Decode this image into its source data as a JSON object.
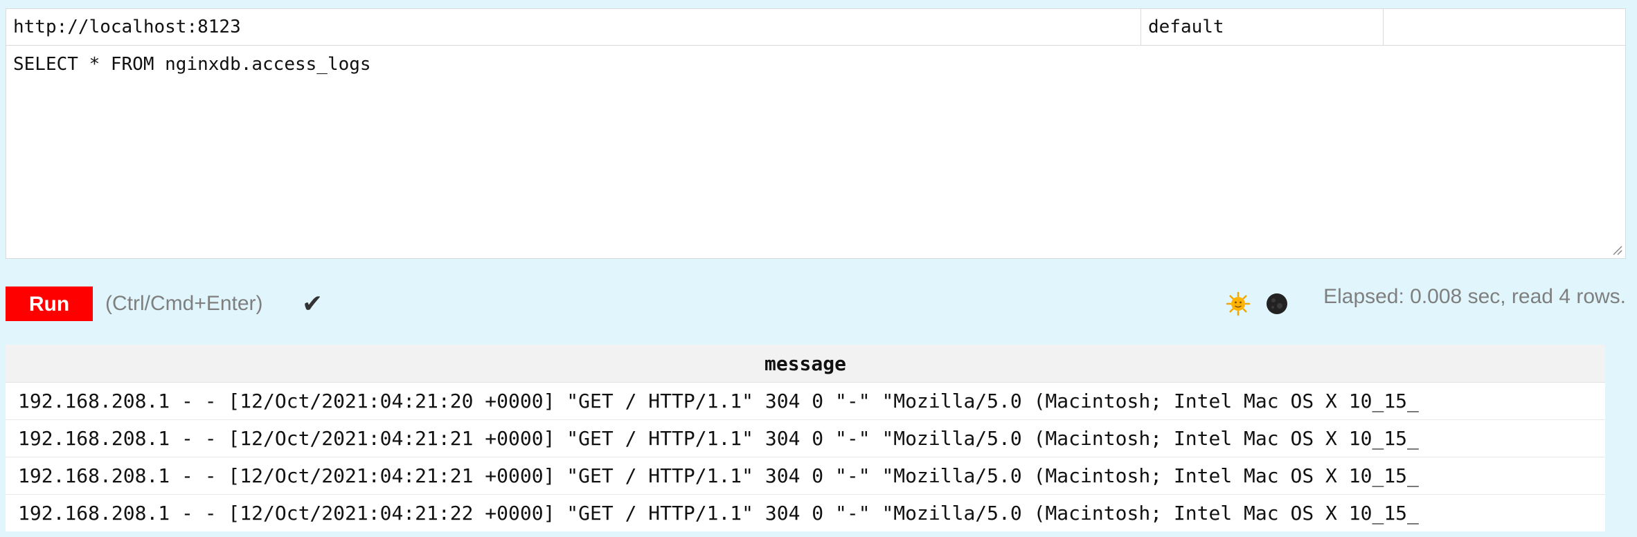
{
  "connection": {
    "url": "http://localhost:8123",
    "user": "default",
    "password": ""
  },
  "query": {
    "text": "SELECT * FROM nginxdb.access_logs"
  },
  "controls": {
    "run_label": "Run",
    "shortcut_hint": "(Ctrl/Cmd+Enter)",
    "status_check": "✔",
    "elapsed": "Elapsed: 0.008 sec, read 4 rows."
  },
  "theme": {
    "light_icon": "sun-icon",
    "dark_icon": "moon-icon",
    "run_color": "#ff0000",
    "background": "#e0f6fc"
  },
  "results": {
    "columns": [
      "message"
    ],
    "rows": [
      "192.168.208.1 - - [12/Oct/2021:04:21:20 +0000] \"GET / HTTP/1.1\" 304 0 \"-\" \"Mozilla/5.0 (Macintosh; Intel Mac OS X 10_15_",
      "192.168.208.1 - - [12/Oct/2021:04:21:21 +0000] \"GET / HTTP/1.1\" 304 0 \"-\" \"Mozilla/5.0 (Macintosh; Intel Mac OS X 10_15_",
      "192.168.208.1 - - [12/Oct/2021:04:21:21 +0000] \"GET / HTTP/1.1\" 304 0 \"-\" \"Mozilla/5.0 (Macintosh; Intel Mac OS X 10_15_",
      "192.168.208.1 - - [12/Oct/2021:04:21:22 +0000] \"GET / HTTP/1.1\" 304 0 \"-\" \"Mozilla/5.0 (Macintosh; Intel Mac OS X 10_15_"
    ]
  }
}
